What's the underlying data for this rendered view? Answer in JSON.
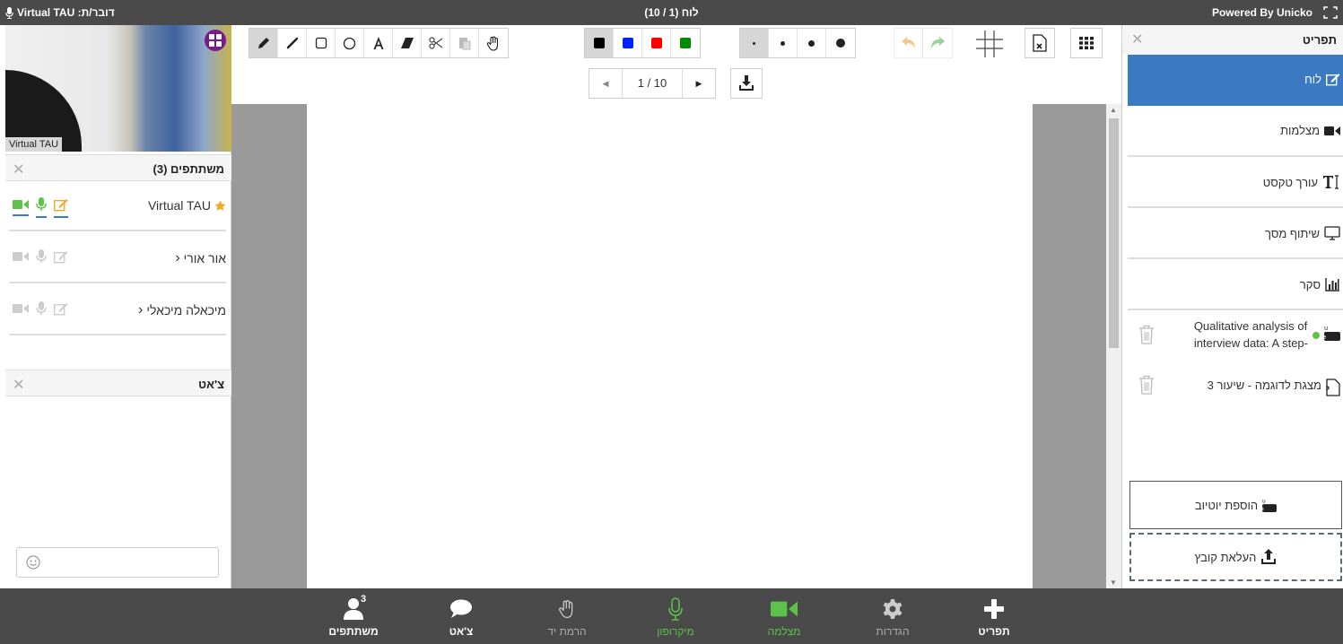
{
  "topbar": {
    "speaking_label": "דובר/ת: Virtual TAU",
    "board_title": "לוח (1 / 10)",
    "powered_by": "Powered By Unicko"
  },
  "video": {
    "name": "Virtual TAU"
  },
  "participants": {
    "title": "משתתפים (3)",
    "rows": [
      {
        "name": "Virtual TAU"
      },
      {
        "name": "אור אורי"
      },
      {
        "name": "מיכאלה מיכאלי"
      }
    ]
  },
  "chat": {
    "title": "צ'אט"
  },
  "toolbar": {
    "pager_text": "1 / 10",
    "colors": {
      "black": "#000000",
      "blue": "#0021ff",
      "red": "#ff0000",
      "green": "#008a00"
    }
  },
  "menu": {
    "title": "תפריט",
    "items": [
      {
        "label": "לוח"
      },
      {
        "label": "מצלמות"
      },
      {
        "label": "עורך טקסט"
      },
      {
        "label": "שיתוף מסך"
      },
      {
        "label": "סקר"
      }
    ],
    "files": [
      {
        "line1": "Qualitative analysis of",
        "line2": "interview data: A step-"
      },
      {
        "line1": "מצגת לדוגמה - שיעור 3"
      }
    ],
    "add_youtube": "הוספת יוטיוב",
    "upload_file": "העלאת קובץ"
  },
  "bottom": {
    "participants": "משתתפים",
    "participants_count": "3",
    "chat": "צ'אט",
    "raise_hand": "הרמת יד",
    "microphone": "מיקרופון",
    "camera": "מצלמה",
    "settings": "הגדרות",
    "menu": "תפריט"
  },
  "accent": {
    "blue": "#3a7ac2",
    "green": "#5cc24a",
    "orange": "#f5a623"
  }
}
